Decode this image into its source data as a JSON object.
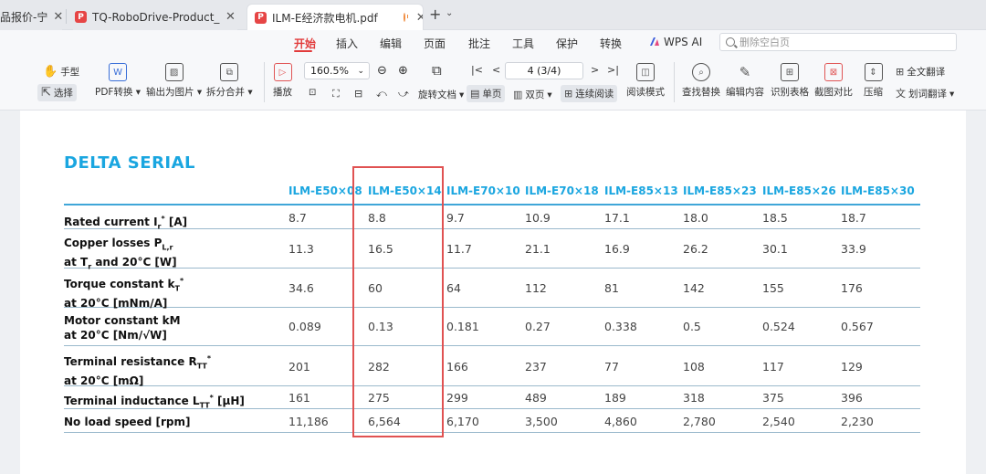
{
  "tabs": [
    {
      "title": "品报价-宁",
      "active": false
    },
    {
      "title": "TQ-RoboDrive-Product_Info_EN-",
      "active": false
    },
    {
      "title": "ILM-E经济款电机.pdf",
      "active": true
    }
  ],
  "menu": {
    "items": [
      "开始",
      "插入",
      "编辑",
      "页面",
      "批注",
      "工具",
      "保护",
      "转换"
    ],
    "wps_ai": "WPS AI",
    "search_placeholder": "删除空白页"
  },
  "toolbar": {
    "hand": "手型",
    "select": "选择",
    "pdf_convert": "PDF转换",
    "export_image": "输出为图片",
    "split_merge": "拆分合并",
    "play": "播放",
    "zoom": "160.5%",
    "rotate_doc": "旋转文档",
    "single_page": "单页",
    "double_page": "双页",
    "continuous": "连续阅读",
    "page_value": "4 (3/4)",
    "read_mode": "阅读模式",
    "find_replace": "查找替换",
    "edit_content": "编辑内容",
    "recognize_table": "识别表格",
    "screenshot_compare": "截图对比",
    "compress": "压缩",
    "full_translate": "全文翻译",
    "word_translate": "划词翻译"
  },
  "document": {
    "heading": "DELTA SERIAL",
    "columns": [
      "ILM-E50×08",
      "ILM-E50×14",
      "ILM-E70×10",
      "ILM-E70×18",
      "ILM-E85×13",
      "ILM-E85×23",
      "ILM-E85×26",
      "ILM-E85×30"
    ],
    "rows": [
      {
        "label_line1": "Rated current I",
        "label_sub1": "r",
        "label_sup1": "*",
        "label_tail1": " [A]",
        "label_line2": "",
        "values": [
          "8.7",
          "8.8",
          "9.7",
          "10.9",
          "17.1",
          "18.0",
          "18.5",
          "18.7"
        ]
      },
      {
        "label_line1": "Copper losses P",
        "label_sub1": "L,r",
        "label_sup1": "",
        "label_tail1": "",
        "label_line2": "at T",
        "label_sub2": "r",
        "label_tail2": " and 20°C [W]",
        "values": [
          "11.3",
          "16.5",
          "11.7",
          "21.1",
          "16.9",
          "26.2",
          "30.1",
          "33.9"
        ]
      },
      {
        "label_line1": "Torque constant k",
        "label_sub1": "T",
        "label_sup1": "*",
        "label_tail1": "",
        "label_line2": "at 20°C [mNm/A]",
        "values": [
          "34.6",
          "60",
          "64",
          "112",
          "81",
          "142",
          "155",
          "176"
        ]
      },
      {
        "label_line1": "Motor constant kM",
        "label_sub1": "",
        "label_sup1": "",
        "label_tail1": "",
        "label_line2": "at 20°C [Nm/√W]",
        "values": [
          "0.089",
          "0.13",
          "0.181",
          "0.27",
          "0.338",
          "0.5",
          "0.524",
          "0.567"
        ]
      },
      {
        "label_line1": "Terminal resistance R",
        "label_sub1": "TT",
        "label_sup1": "*",
        "label_tail1": "",
        "label_line2": "at 20°C [mΩ]",
        "values": [
          "201",
          "282",
          "166",
          "237",
          "77",
          "108",
          "117",
          "129"
        ]
      },
      {
        "label_line1": "Terminal inductance L",
        "label_sub1": "TT",
        "label_sup1": "*",
        "label_tail1": " [µH]",
        "label_line2": "",
        "values": [
          "161",
          "275",
          "299",
          "489",
          "189",
          "318",
          "375",
          "396"
        ]
      },
      {
        "label_line1": "No load speed [rpm]",
        "label_sub1": "",
        "label_sup1": "",
        "label_tail1": "",
        "label_line2": "",
        "values": [
          "11,186",
          "6,564",
          "6,170",
          "3,500",
          "4,860",
          "2,780",
          "2,540",
          "2,230"
        ]
      }
    ]
  },
  "colors": {
    "accent": "#1aa6e0",
    "highlight": "#e05252",
    "menu_active": "#e23b3b"
  }
}
